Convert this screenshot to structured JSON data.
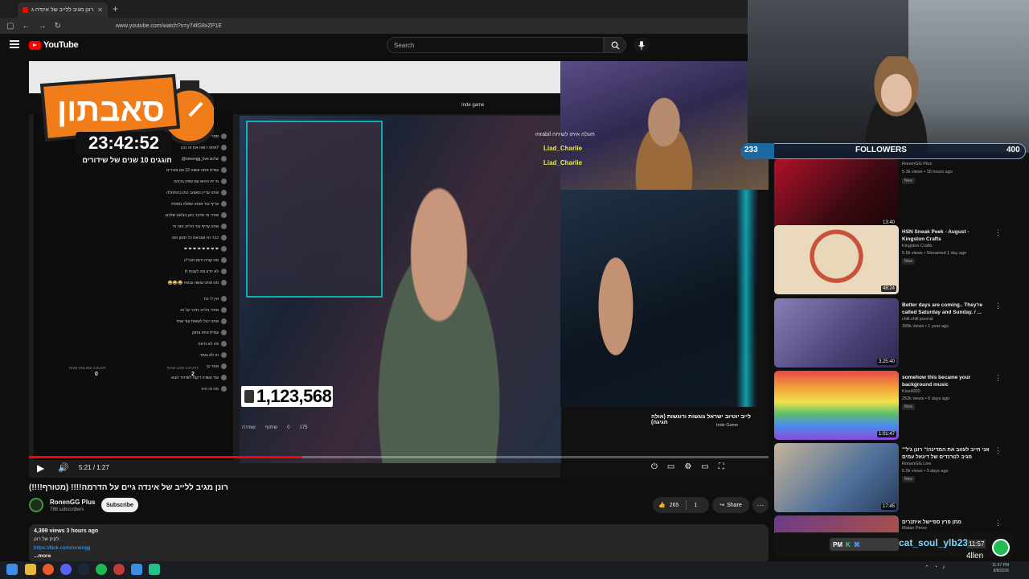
{
  "browser": {
    "tab_title": "רונן מגיב ללייב של אינדה ג",
    "url": "www.youtube.com/watch?v=y74fG8xZP1E"
  },
  "youtube": {
    "logo_text": "YouTube",
    "search_placeholder": "Search"
  },
  "player": {
    "nested_tab_title": "Inde game",
    "timer": "23:42:52",
    "timer_subtitle": "חוגגים 10 שנים של שידורים",
    "counter": "1,123,568",
    "cam_chat": [
      {
        "text": "mrabil תעלה איתו לשיחה"
      },
      {
        "text": "Liad_Charlie"
      },
      {
        "text": "Liad_Charlie"
      }
    ],
    "caption": "לייב יוטיוב ישראל גוגשות ורוגשות (אולה חגיגה)",
    "caption_sub": "Inde Game",
    "raw_online_label": "RAW ONLINE COUNT",
    "raw_online_value": "0",
    "raw_like_label": "RAW LIKE COUNT",
    "raw_like_value": "2",
    "actions": [
      "שמירה",
      "שיתוף",
      "0",
      "175"
    ],
    "time": "5:21 / 1:27",
    "progress": 0.37
  },
  "video": {
    "title": "רונן מגיב ללייב של אינדה גיים על הדרמה!!!! (מטורף!!!!)",
    "channel_name": "RonenGG Plus",
    "channel_subs": "788 subscribers",
    "subscribe_label": "Subscribe",
    "likes": "265",
    "dislikes": "1",
    "share_label": "Share",
    "views_date": "4,399 views  3 hours ago",
    "desc_line": "לקיק של רונן:",
    "desc_link": "https://kick.com/ronengg",
    "more_label": "...more"
  },
  "sidebar": {
    "items": [
      {
        "title": "",
        "channel": "RonenGG Plus",
        "meta": "5.3k views • 15 hours ago",
        "badge": "New",
        "duration": "13:40"
      },
      {
        "title": "HSN Sneak Peek - August - Kingston Crafts",
        "channel": "Kingston Crafts",
        "meta": "5.6k views • Streamed 1 day ago",
        "badge": "New",
        "duration": "48:24"
      },
      {
        "title": "Better days are coming.. They're called Saturday and Sunday. / ...",
        "channel": "chill chill journal",
        "meta": "395k views • 1 year ago",
        "badge": "",
        "duration": "3:25:40"
      },
      {
        "title": "somehow this became your background music",
        "channel": "Kiss4000",
        "meta": "252k views • 6 days ago",
        "badge": "New",
        "duration": "1:01:47"
      },
      {
        "title": "\"אני חייב לעזוב את המדינה!\" רונן ג'ל' מגיב לטרנדים של דיגאל עמים",
        "channel": "RonenGG Live",
        "meta": "5.5k views • 3 days ago",
        "badge": "New",
        "duration": "17:45"
      },
      {
        "title": "מתן פרץ ספיישל איתנרים",
        "channel": "Matan Perez",
        "meta": "",
        "badge": "",
        "duration": ""
      }
    ]
  },
  "overlay": {
    "followers_current": "233",
    "followers_label": "FOLLOWERS",
    "followers_goal": "400",
    "alert_pm": "PM",
    "alert_name": "cat_soul_ylb23",
    "alert_time": "11:57",
    "alert_user": "4llen"
  },
  "taskbar": {
    "time": "11:57 PM",
    "date": "8/8/2026"
  }
}
